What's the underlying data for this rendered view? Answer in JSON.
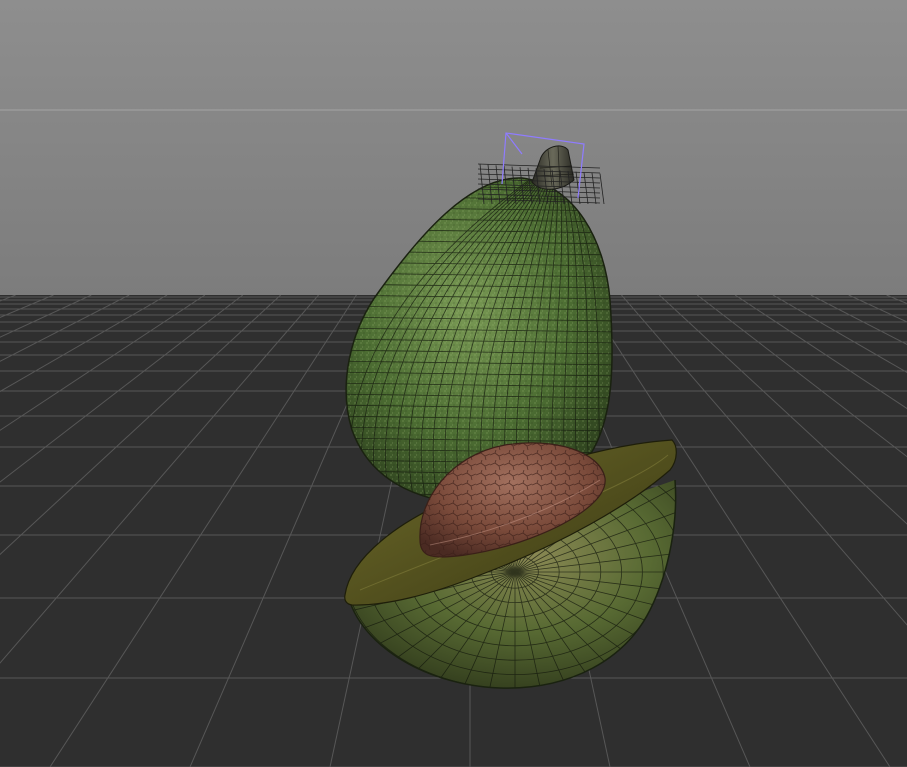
{
  "viewport": {
    "background_top": "#8a8a8a",
    "background_bottom": "#5e5e5e",
    "floor_color": "#2e2e2e",
    "grid_line_color": "#565656",
    "selection_color": "#8f7cff",
    "wireframe_color": "#1a1a1a"
  },
  "scene": {
    "objects": [
      {
        "name": "whole-avocado",
        "skin_color": "#4e7034",
        "stem_color": "#3a3a32"
      },
      {
        "name": "half-avocado",
        "flesh_color": "#5c5a22",
        "pit_color": "#7a4a3c"
      }
    ]
  }
}
